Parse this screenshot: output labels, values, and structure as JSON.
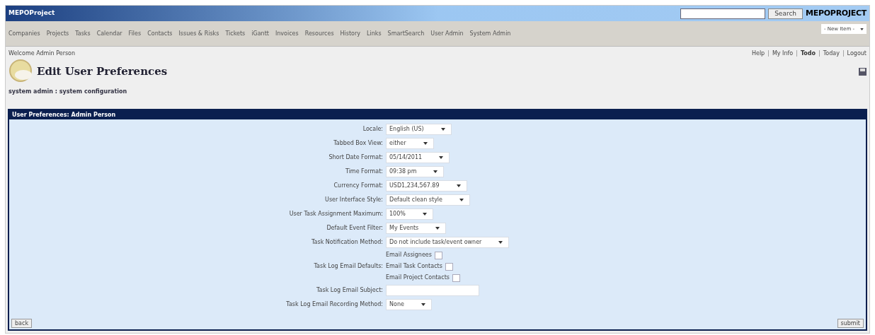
{
  "app_title": "MEPOProject",
  "search": {
    "button": "Search"
  },
  "logo": "MEPOPROJECT",
  "nav": [
    "Companies",
    "Projects",
    "Tasks",
    "Calendar",
    "Files",
    "Contacts",
    "Issues & Risks",
    "Tickets",
    "iGantt",
    "Invoices",
    "Resources",
    "History",
    "Links",
    "SmartSearch",
    "User Admin",
    "System Admin"
  ],
  "new_item": "- New Item -",
  "welcome": "Welcome Admin Person",
  "user_links": [
    {
      "kind": "link",
      "label": "Help",
      "bold": false
    },
    {
      "kind": "separator",
      "label": "|"
    },
    {
      "kind": "link",
      "label": "My Info",
      "bold": false
    },
    {
      "kind": "separator",
      "label": "|"
    },
    {
      "kind": "link",
      "label": "Todo",
      "bold": true
    },
    {
      "kind": "separator",
      "label": "|"
    },
    {
      "kind": "link",
      "label": "Today",
      "bold": false
    },
    {
      "kind": "separator",
      "label": "|"
    },
    {
      "kind": "link",
      "label": "Logout",
      "bold": false
    }
  ],
  "page_title": "Edit User Preferences",
  "breadcrumb": "system admin : system configuration",
  "panel_title": "User Preferences: Admin Person",
  "fields": [
    {
      "kind": "select",
      "label": "Locale:",
      "value": "English (US)"
    },
    {
      "kind": "select",
      "label": "Tabbed Box View:",
      "value": "either"
    },
    {
      "kind": "select",
      "label": "Short Date Format:",
      "value": "05/14/2011"
    },
    {
      "kind": "select",
      "label": "Time Format:",
      "value": "09:38 pm"
    },
    {
      "kind": "select",
      "label": "Currency Format:",
      "value": "USD1,234,567.89"
    },
    {
      "kind": "select",
      "label": "User Interface Style:",
      "value": "Default clean style"
    },
    {
      "kind": "select",
      "label": "User Task Assignment Maximum:",
      "value": "100%"
    },
    {
      "kind": "select",
      "label": "Default Event Filter:",
      "value": "My Events"
    },
    {
      "kind": "select",
      "label": "Task Notification Method:",
      "value": "Do not include task/event owner"
    },
    {
      "kind": "checks",
      "label": "Task Log Email Defaults:",
      "options": [
        {
          "label": "Email Assignees",
          "checked": false
        },
        {
          "label": "Email Task Contacts",
          "checked": false
        },
        {
          "label": "Email Project Contacts",
          "checked": false
        }
      ]
    },
    {
      "kind": "text",
      "label": "Task Log Email Subject:"
    },
    {
      "kind": "select",
      "label": "Task Log Email Recording Method:",
      "value": "None"
    }
  ],
  "back": "back",
  "submit": "submit"
}
